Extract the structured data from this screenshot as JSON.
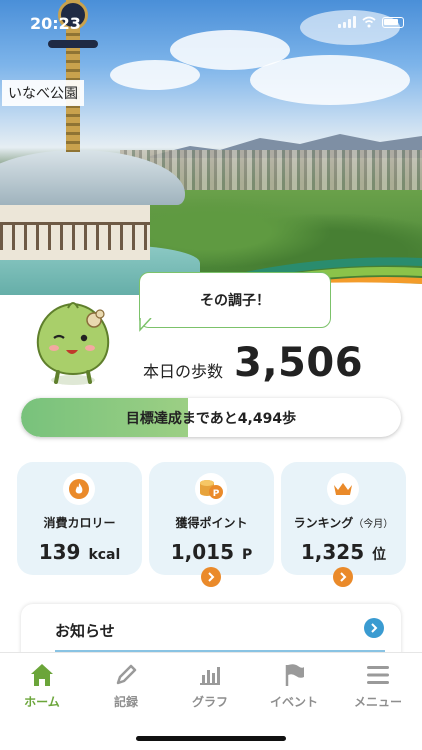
{
  "status_bar": {
    "time": "20:23"
  },
  "hero": {
    "place_label": "いなべ公園"
  },
  "mascot": {
    "speech": "その調子！"
  },
  "steps": {
    "label": "本日の歩数",
    "value": "3,506"
  },
  "goal": {
    "text": "目標達成まであと4,494歩",
    "progress_fraction": 0.44
  },
  "cards": [
    {
      "title": "消費カロリー",
      "value": "139",
      "unit": "kcal",
      "icon": "flame-icon"
    },
    {
      "title": "獲得ポイント",
      "value": "1,015",
      "unit": "P",
      "icon": "coins-icon"
    },
    {
      "title": "ランキング",
      "subtitle": "（今月）",
      "value": "1,325",
      "unit": "位",
      "icon": "crown-icon"
    }
  ],
  "news": {
    "title": "お知らせ"
  },
  "tabs": [
    {
      "label": "ホーム",
      "icon": "home-icon",
      "active": true
    },
    {
      "label": "記録",
      "icon": "pencil-icon"
    },
    {
      "label": "グラフ",
      "icon": "bar-chart-icon"
    },
    {
      "label": "イベント",
      "icon": "flag-icon"
    },
    {
      "label": "メニュー",
      "icon": "menu-icon"
    }
  ],
  "colors": {
    "accent_green": "#6ba53a",
    "accent_orange": "#ea8a2a",
    "accent_blue": "#3a9bd1",
    "card_bg": "#e8f3f9"
  }
}
